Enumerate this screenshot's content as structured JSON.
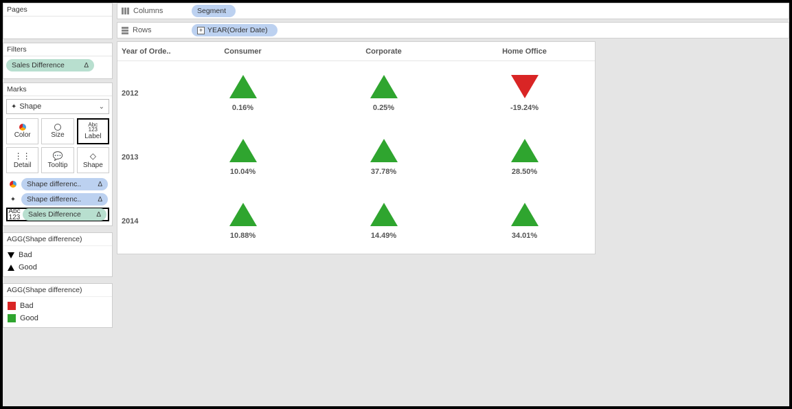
{
  "sidebar": {
    "pages_title": "Pages",
    "filters_title": "Filters",
    "filter_pill": "Sales Difference",
    "marks_title": "Marks",
    "marks_type": "Shape",
    "mark_cells": {
      "color": "Color",
      "size": "Size",
      "label": "Label",
      "detail": "Detail",
      "tooltip": "Tooltip",
      "shape": "Shape"
    },
    "assignments": {
      "a1": "Shape differenc..",
      "a2": "Shape differenc..",
      "a3": "Sales Difference"
    }
  },
  "legend_shape": {
    "title": "AGG(Shape difference)",
    "bad": "Bad",
    "good": "Good"
  },
  "legend_color": {
    "title": "AGG(Shape difference)",
    "bad": "Bad",
    "good": "Good"
  },
  "shelves": {
    "columns_label": "Columns",
    "columns_pill": "Segment",
    "rows_label": "Rows",
    "rows_pill": "YEAR(Order Date)"
  },
  "viz": {
    "row_header": "Year of Orde..",
    "col1": "Consumer",
    "col2": "Corporate",
    "col3": "Home Office",
    "y2012": "2012",
    "y2013": "2013",
    "y2014": "2014",
    "v_2012_consumer": "0.16%",
    "v_2012_corporate": "0.25%",
    "v_2012_home": "-19.24%",
    "v_2013_consumer": "10.04%",
    "v_2013_corporate": "37.78%",
    "v_2013_home": "28.50%",
    "v_2014_consumer": "10.88%",
    "v_2014_corporate": "14.49%",
    "v_2014_home": "34.01%"
  },
  "chart_data": {
    "type": "table",
    "title": "Sales Difference by Segment and Year",
    "row_field": "Year of Order Date",
    "col_field": "Segment",
    "columns": [
      "Consumer",
      "Corporate",
      "Home Office"
    ],
    "rows": [
      "2012",
      "2013",
      "2014"
    ],
    "values_percent": [
      [
        0.16,
        0.25,
        -19.24
      ],
      [
        10.04,
        37.78,
        28.5
      ],
      [
        10.88,
        14.49,
        34.01
      ]
    ],
    "shape_rule": "value >= 0 => up triangle (Good); value < 0 => down triangle (Bad)",
    "color_rule": "Good => green (#2fa52f); Bad => red (#d92525)"
  }
}
